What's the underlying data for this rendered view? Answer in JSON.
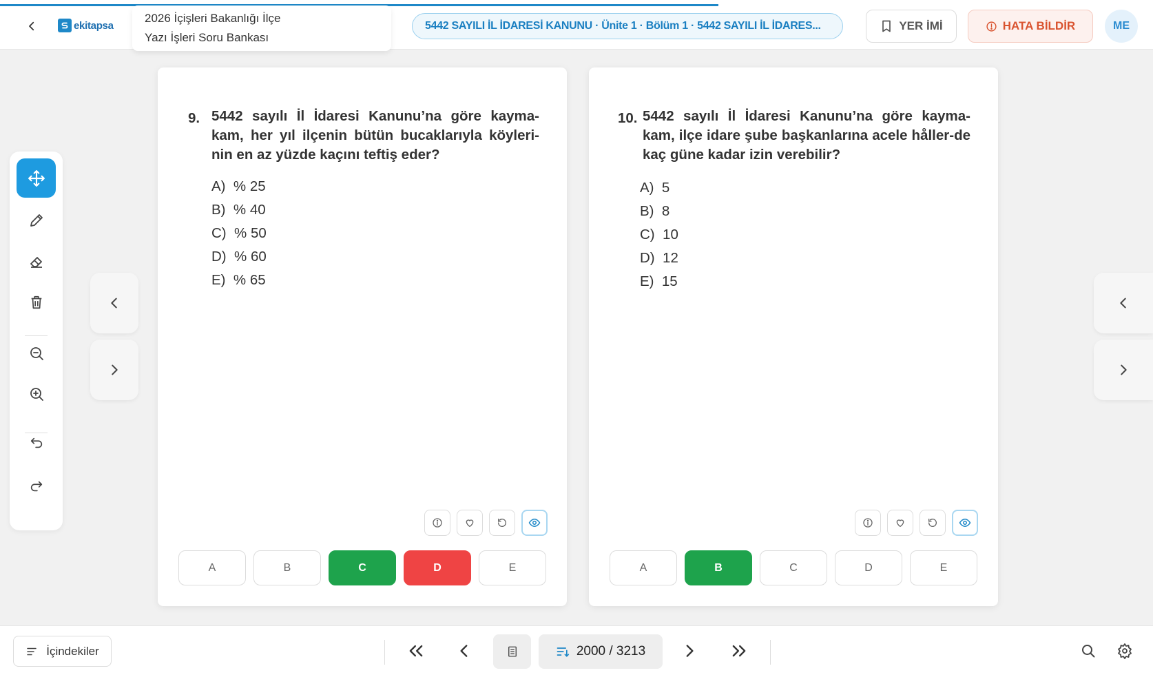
{
  "header": {
    "logo_text": "ekitapsa",
    "book_title_line1": "2026 İçişleri Bakanlığı İlçe",
    "book_title_line2": "Yazı İşleri Soru Bankası",
    "breadcrumb": "5442 SAYILI İL İDARESİ KANUNU · Ünite 1 · Bölüm 1 · 5442 SAYILI İL İDARES...",
    "bookmark_label": "YER İMİ",
    "report_label": "HATA BİLDİR",
    "avatar_initials": "ME"
  },
  "toolbar": {
    "tools": [
      "move-icon",
      "pencil-icon",
      "eraser-icon",
      "trash-icon",
      "zoom-out-icon",
      "zoom-in-icon",
      "undo-icon",
      "redo-icon"
    ],
    "active_color": "#1e9be0"
  },
  "questions": [
    {
      "number": "9.",
      "text": "5442 sayılı İl İdaresi Kanunu’na göre kayma-kam, her yıl ilçenin bütün bucaklarıyla köyleri-nin en az yüzde kaçını teftiş eder?",
      "options": [
        {
          "letter": "A)",
          "text": "% 25"
        },
        {
          "letter": "B)",
          "text": "% 40"
        },
        {
          "letter": "C)",
          "text": "% 50"
        },
        {
          "letter": "D)",
          "text": "% 60"
        },
        {
          "letter": "E)",
          "text": "% 65"
        }
      ],
      "answers": [
        {
          "label": "A",
          "state": "none"
        },
        {
          "label": "B",
          "state": "none"
        },
        {
          "label": "C",
          "state": "correct"
        },
        {
          "label": "D",
          "state": "wrong"
        },
        {
          "label": "E",
          "state": "none"
        }
      ]
    },
    {
      "number": "10.",
      "text": "5442 sayılı İl İdaresi Kanunu’na göre kayma-kam, ilçe idare şube başkanlarına acele håller-de kaç güne kadar izin verebilir?",
      "options": [
        {
          "letter": "A)",
          "text": "5"
        },
        {
          "letter": "B)",
          "text": "8"
        },
        {
          "letter": "C)",
          "text": "10"
        },
        {
          "letter": "D)",
          "text": "12"
        },
        {
          "letter": "E)",
          "text": "15"
        }
      ],
      "answers": [
        {
          "label": "A",
          "state": "none"
        },
        {
          "label": "B",
          "state": "correct"
        },
        {
          "label": "C",
          "state": "none"
        },
        {
          "label": "D",
          "state": "none"
        },
        {
          "label": "E",
          "state": "none"
        }
      ]
    }
  ],
  "footer": {
    "toc_label": "İçindekiler",
    "page_counter": "2000 / 3213"
  },
  "colors": {
    "correct": "#1ea34c",
    "wrong": "#ef4444",
    "accent": "#1e88c8"
  }
}
